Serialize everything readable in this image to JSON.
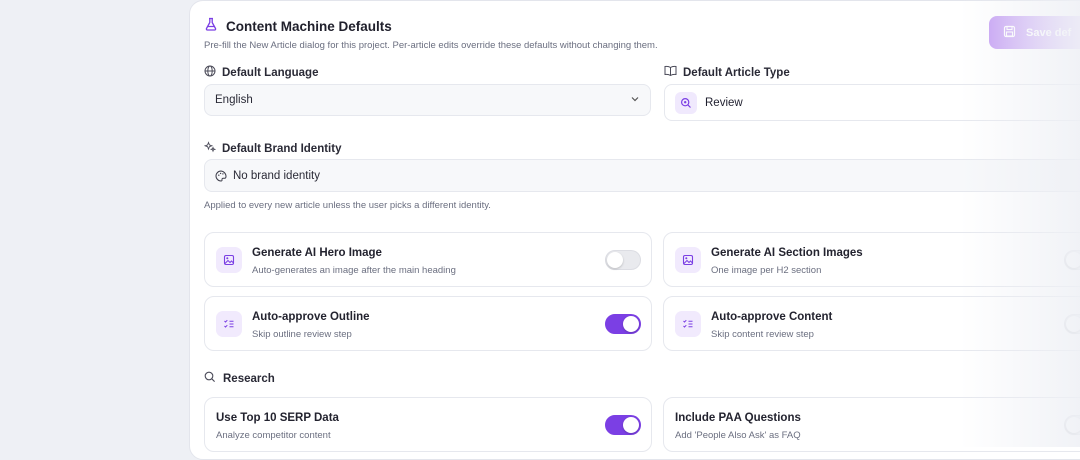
{
  "header": {
    "title": "Content Machine Defaults",
    "subtitle": "Pre-fill the New Article dialog for this project. Per-article edits override these defaults without changing them.",
    "save_label": "Save def"
  },
  "language": {
    "label": "Default Language",
    "value": "English"
  },
  "article_type": {
    "label": "Default Article Type",
    "value": "Review"
  },
  "brand": {
    "label": "Default Brand Identity",
    "value": "No brand identity",
    "help": "Applied to every new article unless the user picks a different identity."
  },
  "options": [
    {
      "title": "Generate AI Hero Image",
      "subtitle": "Auto-generates an image after the main heading",
      "enabled": false
    },
    {
      "title": "Generate AI Section Images",
      "subtitle": "One image per H2 section",
      "enabled": false
    },
    {
      "title": "Auto-approve Outline",
      "subtitle": "Skip outline review step",
      "enabled": true
    },
    {
      "title": "Auto-approve Content",
      "subtitle": "Skip content review step",
      "enabled": false
    }
  ],
  "research": {
    "label": "Research",
    "options": [
      {
        "title": "Use Top 10 SERP Data",
        "subtitle": "Analyze competitor content",
        "enabled": true
      },
      {
        "title": "Include PAA Questions",
        "subtitle": "Add 'People Also Ask' as FAQ",
        "enabled": false
      }
    ]
  },
  "colors": {
    "accent": "#7b3fe4",
    "accent_light": "#f1eafd",
    "background": "#eef0f5"
  }
}
